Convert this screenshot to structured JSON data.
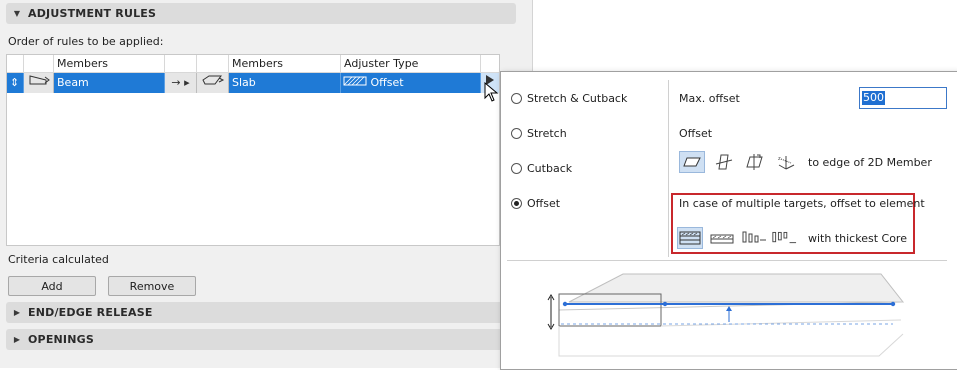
{
  "sections": {
    "adjustment_rules": "ADJUSTMENT RULES",
    "end_edge_release": "END/EDGE RELEASE",
    "openings": "OPENINGS"
  },
  "order_label": "Order of rules to be applied:",
  "grid": {
    "headers": {
      "members_1": "Members",
      "members_2": "Members",
      "adjuster_type": "Adjuster Type"
    },
    "row": {
      "member_1": "Beam",
      "member_2": "Slab",
      "adjuster": "Offset"
    }
  },
  "criteria_label": "Criteria calculated",
  "buttons": {
    "add": "Add",
    "remove": "Remove"
  },
  "popup": {
    "options": {
      "stretch_cutback": "Stretch & Cutback",
      "stretch": "Stretch",
      "cutback": "Cutback",
      "offset": "Offset"
    },
    "selected_option": "Offset",
    "max_offset_label": "Max. offset",
    "max_offset_value": "500",
    "offset_label": "Offset",
    "to_edge_label": "to edge of 2D Member",
    "multiple_targets_label": "In case of multiple targets, offset to element",
    "thickest_core_label": "with thickest Core"
  },
  "colors": {
    "selection": "#1f7ad6",
    "highlight_box": "#c8282c",
    "preview_line": "#2d6fd6"
  }
}
